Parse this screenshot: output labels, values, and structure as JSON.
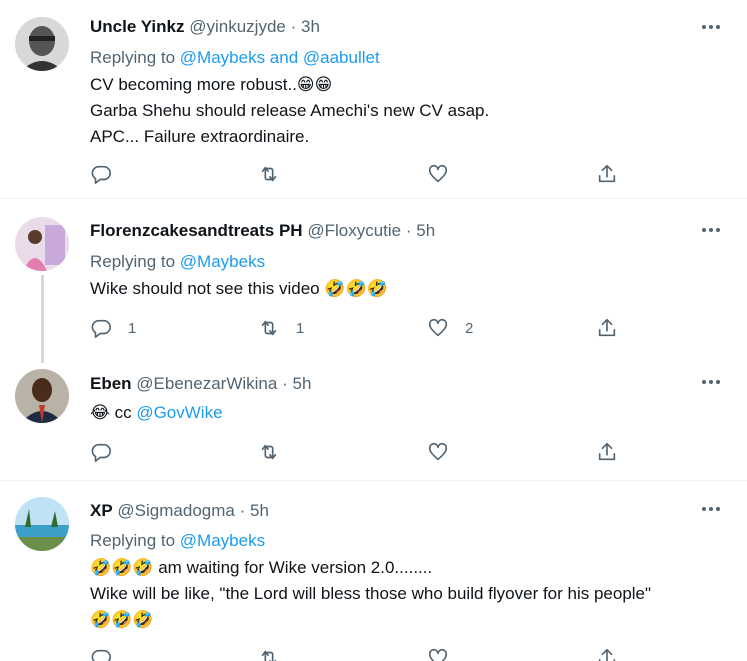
{
  "tweets": [
    {
      "name": "Uncle Yinkz",
      "handle": "@yinkuzjyde",
      "time": "3h",
      "replying_prefix": "Replying to ",
      "mentions": [
        "@Maybeks",
        "@aabullet"
      ],
      "mention_joiner": " and ",
      "lines": [
        "CV becoming more robust..😁😁",
        "Garba Shehu should release Amechi's new CV asap.",
        "APC... Failure extraordinaire."
      ],
      "counts": {
        "reply": "",
        "retweet": "",
        "like": ""
      }
    },
    {
      "name": "Florenzcakesandtreats PH",
      "handle": "@Floxycutie",
      "time": "5h",
      "replying_prefix": "Replying to ",
      "mentions": [
        "@Maybeks"
      ],
      "lines": [
        "Wike should not see this video 🤣🤣🤣"
      ],
      "counts": {
        "reply": "1",
        "retweet": "1",
        "like": "2"
      }
    },
    {
      "name": "Eben",
      "handle": "@EbenezarWikina",
      "time": "5h",
      "emoji": "😂",
      "cc_text": " cc ",
      "cc_mention": "@GovWike",
      "counts": {
        "reply": "",
        "retweet": "",
        "like": ""
      }
    },
    {
      "name": "XP",
      "handle": "@Sigmadogma",
      "time": "5h",
      "replying_prefix": "Replying to ",
      "mentions": [
        "@Maybeks"
      ],
      "lines": [
        "🤣🤣🤣 am waiting for Wike version 2.0........",
        "Wike will be like, \"the Lord will bless those who build flyover for his people\"",
        "🤣🤣🤣"
      ]
    }
  ],
  "separator": "·",
  "icons": [
    "more-icon",
    "reply-icon",
    "retweet-icon",
    "like-icon",
    "share-icon"
  ],
  "colors": {
    "accent": "#1d9bf0",
    "secondary_text": "#536471",
    "divider": "#eff3f4",
    "thread_line": "#cfd9de"
  }
}
